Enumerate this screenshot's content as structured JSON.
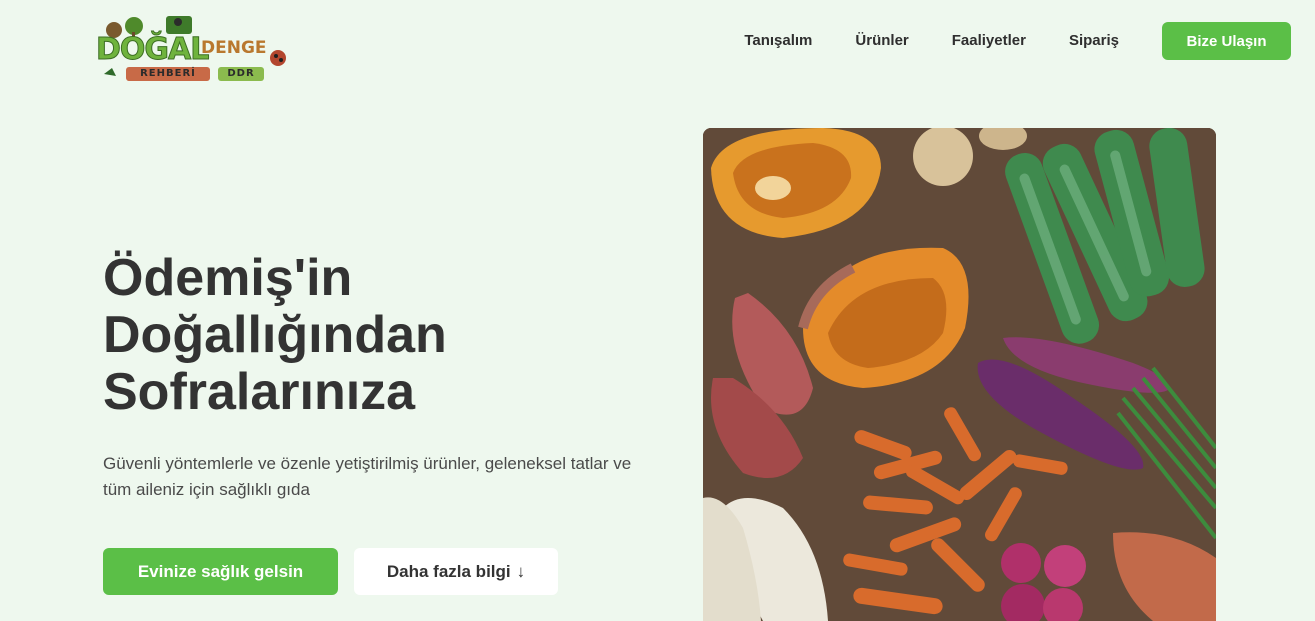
{
  "logo": {
    "word1": "DOĞAL",
    "word2": "DENGE",
    "word3": "REHBERİ",
    "word4": "DDR"
  },
  "nav": {
    "items": [
      {
        "label": "Tanışalım"
      },
      {
        "label": "Ürünler"
      },
      {
        "label": "Faaliyetler"
      },
      {
        "label": "Sipariş"
      }
    ],
    "cta": "Bize Ulaşın"
  },
  "hero": {
    "title_lines": [
      "Ödemiş'in",
      "Doğallığından",
      "Sofralarınıza"
    ],
    "subtitle": "Güvenli yöntemlerle ve özenle yetiştirilmiş ürünler, geleneksel tatlar ve tüm aileniz için sağlıklı gıda",
    "primary_button": "Evinize sağlık gelsin",
    "secondary_button": "Daha fazla bilgi",
    "secondary_icon": "arrow-down-icon"
  },
  "colors": {
    "background": "#eef8ee",
    "accent": "#5bbf47",
    "text": "#333333"
  }
}
